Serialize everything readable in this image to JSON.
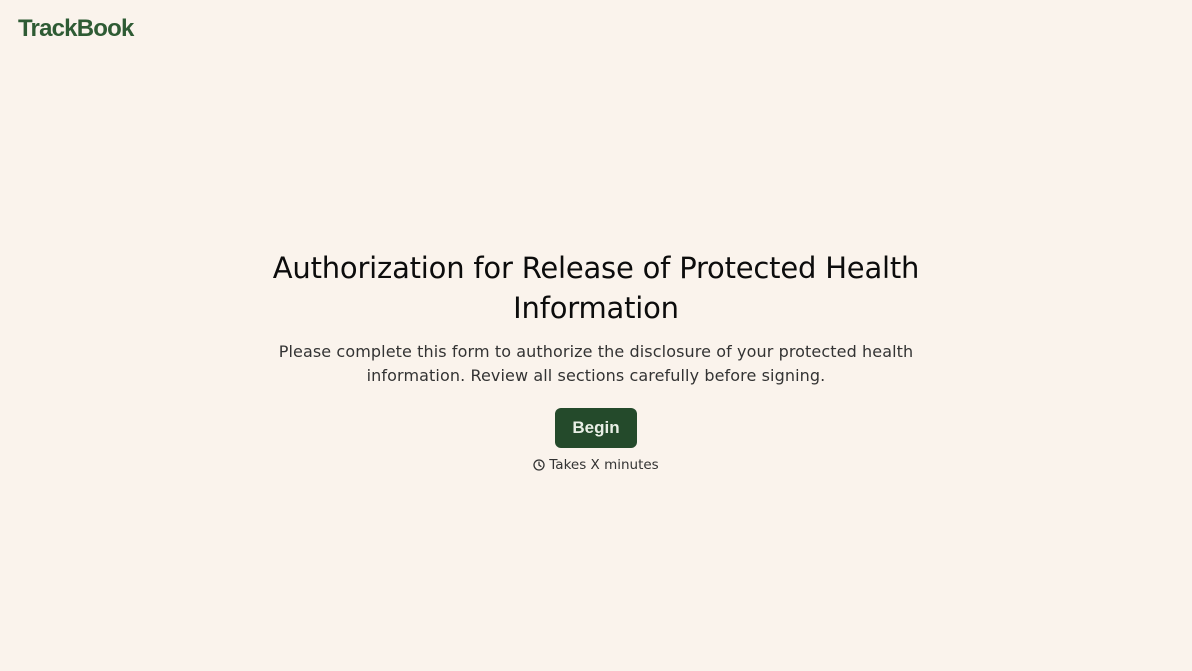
{
  "header": {
    "logo_text": "TrackBook"
  },
  "intro": {
    "title": "Authorization for Release of Protected Health Information",
    "description": "Please complete this form to authorize the disclosure of your protected health information. Review all sections carefully before signing.",
    "begin_label": "Begin",
    "duration_text": "Takes X minutes",
    "duration_icon": "clock-icon"
  },
  "colors": {
    "background": "#faf3ec",
    "brand_green": "#2e5b34",
    "button_green": "#244a2b"
  }
}
